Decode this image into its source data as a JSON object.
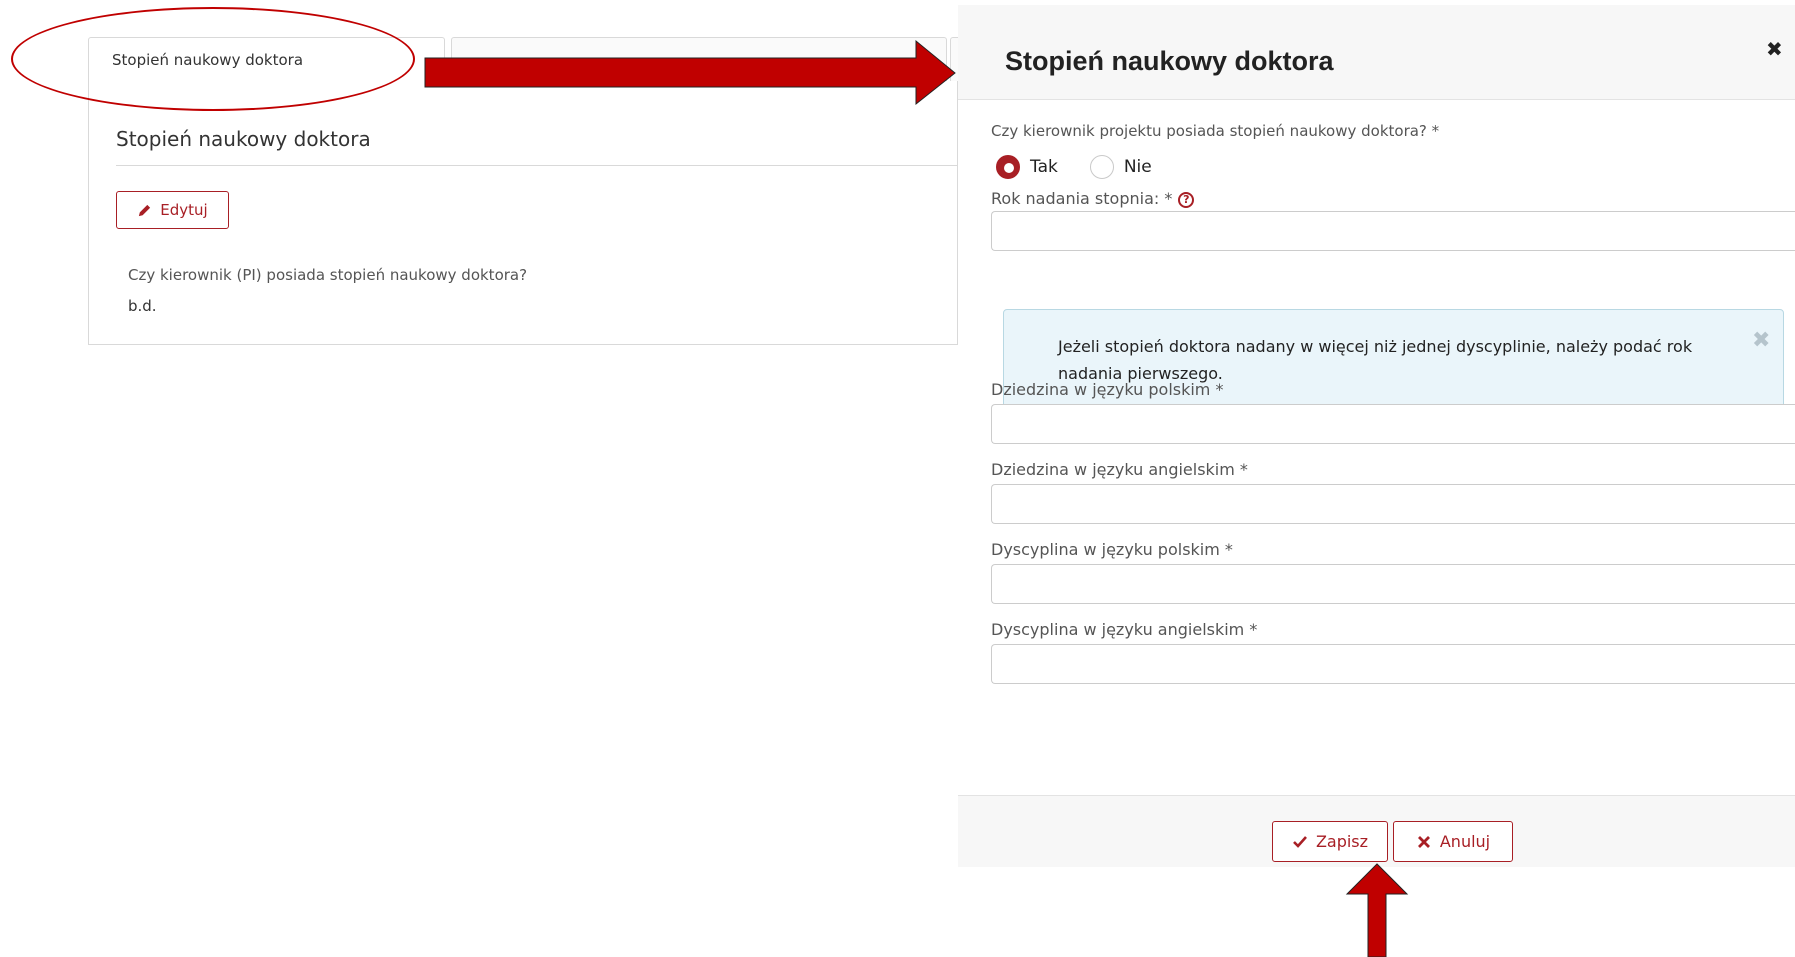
{
  "left": {
    "tab_active_label": "Stopień naukowy doktora",
    "section_title": "Stopień naukowy doktora",
    "edit_label": "Edytuj",
    "field_label": "Czy kierownik (PI) posiada stopień naukowy doktora?",
    "field_value": "b.d."
  },
  "modal": {
    "title": "Stopień naukowy doktora",
    "close_glyph": "✖",
    "question": "Czy kierownik projektu posiada stopień naukowy doktora? *",
    "radio_yes": "Tak",
    "radio_no": "Nie",
    "selected": "Tak",
    "year_label": "Rok nadania stopnia: *",
    "help_glyph": "?",
    "info_text": "Jeżeli stopień doktora nadany w więcej niż jednej dyscyplinie, należy podać rok nadania pierwszego.",
    "info_close_glyph": "✖",
    "fields": {
      "field_pl": "Dziedzina w języku polskim *",
      "field_en": "Dziedzina w języku angielskim *",
      "discipline_pl": "Dyscyplina w języku polskim *",
      "discipline_en": "Dyscyplina w języku angielskim *"
    },
    "year_value": "",
    "field_pl_value": "",
    "field_en_value": "",
    "discipline_pl_value": "",
    "discipline_en_value": "",
    "save_label": "Zapisz",
    "cancel_label": "Anuluj"
  },
  "colors": {
    "accent": "#a81f25",
    "annotation": "#c00000",
    "info_bg": "#eaf5fa"
  }
}
